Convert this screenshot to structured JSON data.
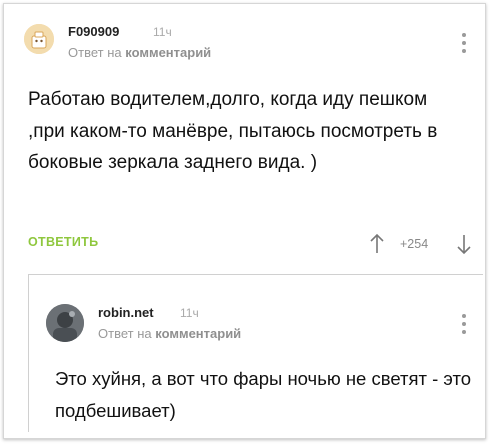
{
  "comment": {
    "username": "F090909",
    "time": "11ч",
    "reply_prefix": "Ответ на",
    "reply_target": "комментарий",
    "text": "Работаю водителем,долго, когда иду пешком ,при каком-то манёвре, пытаюсь посмотреть в боковые зеркала заднего вида. )",
    "reply_label": "ОТВЕТИТЬ",
    "rating": "+254"
  },
  "reply": {
    "username": "robin.net",
    "time": "11ч",
    "reply_prefix": "Ответ на",
    "reply_target": "комментарий",
    "text": "Это хуйня, а вот что фары ночью не светят - это подбешивает)"
  },
  "colors": {
    "accent_green": "#8fc73e",
    "muted_gray": "#999999"
  },
  "icons": {
    "upvote": "arrow-up-icon",
    "downvote": "arrow-down-icon",
    "menu": "kebab-menu-icon"
  }
}
